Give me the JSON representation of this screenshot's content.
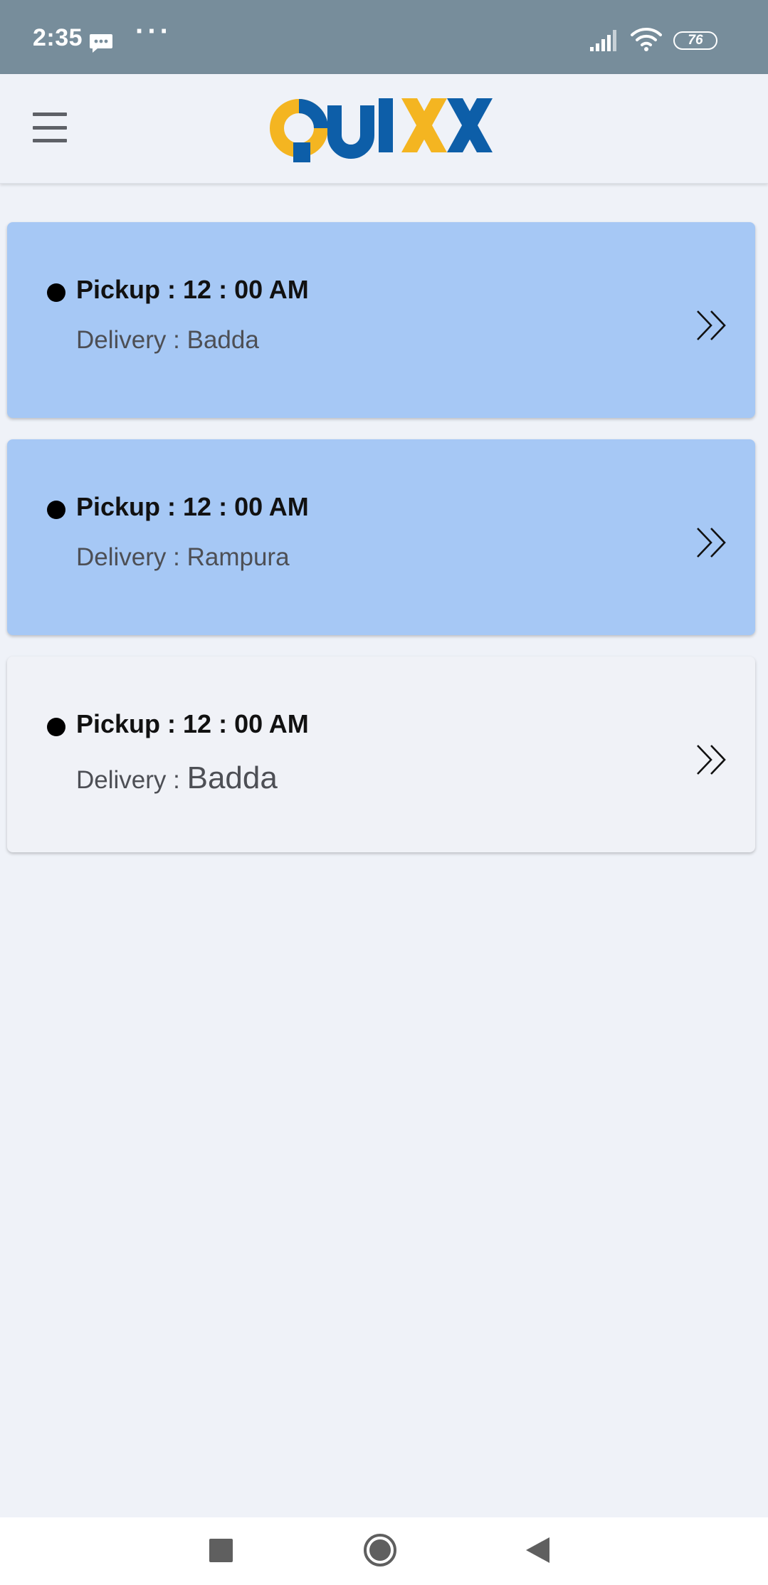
{
  "status_bar": {
    "time": "2:35",
    "message_icon": "message-icon",
    "more_indicator": "···",
    "signal_icon": "signal-icon",
    "wifi_icon": "wifi-icon",
    "battery_level": "76"
  },
  "header": {
    "menu_icon": "hamburger-menu-icon",
    "logo_text": "QUIXX",
    "logo_colors": {
      "yellow": "#f4b521",
      "blue": "#0d5ea8"
    }
  },
  "orders": [
    {
      "pickup": "Pickup : 12 : 00 AM",
      "delivery_label": "Delivery :",
      "delivery_area": "Badda",
      "background": "#a6c8f5"
    },
    {
      "pickup": "Pickup : 12 : 00 AM",
      "delivery_label": "Delivery :",
      "delivery_area": "Rampura",
      "background": "#a6c8f5"
    },
    {
      "pickup": "Pickup : 12 : 00 AM",
      "delivery_label": "Delivery :",
      "delivery_area": "Badda",
      "background": "#f0f2f7"
    }
  ],
  "nav_bar": {
    "recent_icon": "square-recent-apps-icon",
    "home_icon": "circle-home-icon",
    "back_icon": "triangle-back-icon"
  },
  "colors": {
    "status_bar": "#778d9b",
    "page_background": "#eff2f8",
    "card_highlight": "#a6c8f5"
  }
}
